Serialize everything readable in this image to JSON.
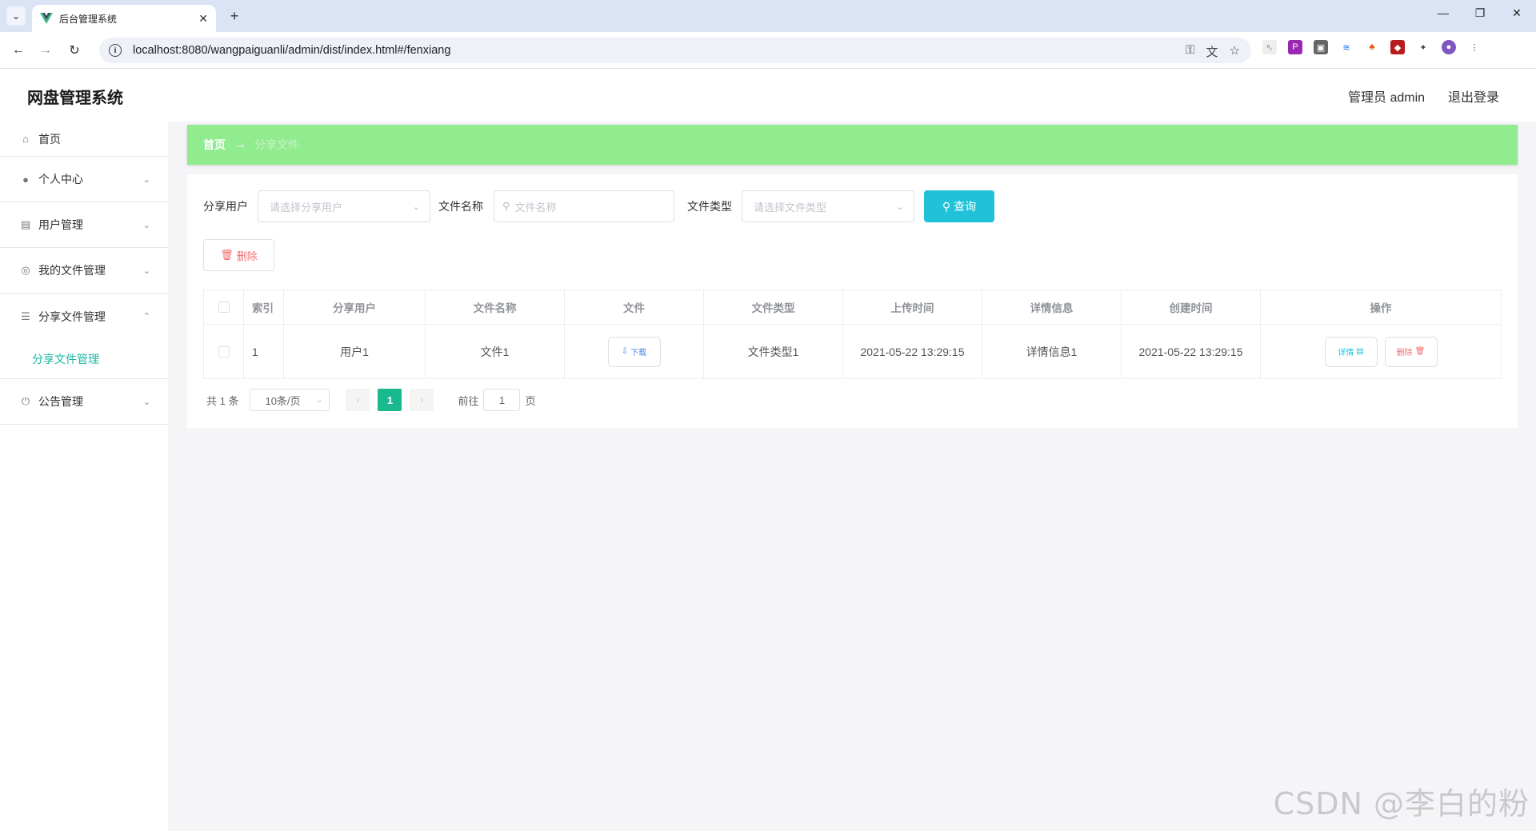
{
  "browser": {
    "tab_title": "后台管理系统",
    "url": "localhost:8080/wangpaiguanli/admin/dist/index.html#/fenxiang"
  },
  "header": {
    "title": "网盘管理系统",
    "user_label": "管理员 admin",
    "logout_label": "退出登录"
  },
  "sidebar": {
    "items": [
      {
        "label": "首页",
        "icon": "home-icon"
      },
      {
        "label": "个人中心",
        "icon": "user-icon"
      },
      {
        "label": "用户管理",
        "icon": "clipboard-icon"
      },
      {
        "label": "我的文件管理",
        "icon": "compass-icon"
      },
      {
        "label": "分享文件管理",
        "icon": "list-icon"
      },
      {
        "label": "公告管理",
        "icon": "power-icon"
      }
    ],
    "sub_item": "分享文件管理",
    "active_color": "#19b9a4"
  },
  "breadcrumb": {
    "home": "首页",
    "separator": "→",
    "current": "分享文件"
  },
  "filters": {
    "share_user_label": "分享用户",
    "share_user_placeholder": "请选择分享用户",
    "file_name_label": "文件名称",
    "file_name_placeholder": "文件名称",
    "file_type_label": "文件类型",
    "file_type_placeholder": "请选择文件类型",
    "query_label": "查询"
  },
  "actions": {
    "delete_label": "删除"
  },
  "table": {
    "headers": [
      "索引",
      "分享用户",
      "文件名称",
      "文件",
      "文件类型",
      "上传时间",
      "详情信息",
      "创建时间",
      "操作"
    ],
    "rows": [
      {
        "index": "1",
        "user": "用户1",
        "file_name": "文件1",
        "download_label": "下载",
        "file_type": "文件类型1",
        "upload_time": "2021-05-22 13:29:15",
        "detail": "详情信息1",
        "created_time": "2021-05-22 13:29:15",
        "detail_btn": "详情",
        "delete_btn": "删除"
      }
    ]
  },
  "pagination": {
    "total": "共 1 条",
    "page_size": "10条/页",
    "current_page": "1",
    "goto_label": "前往",
    "goto_value": "1",
    "page_suffix": "页"
  },
  "watermark": "CSDN @李白的粉",
  "colors": {
    "breadcrumb_bg": "#90ec8e",
    "query_btn": "#20c2d9",
    "pager_active": "#19b98f"
  }
}
